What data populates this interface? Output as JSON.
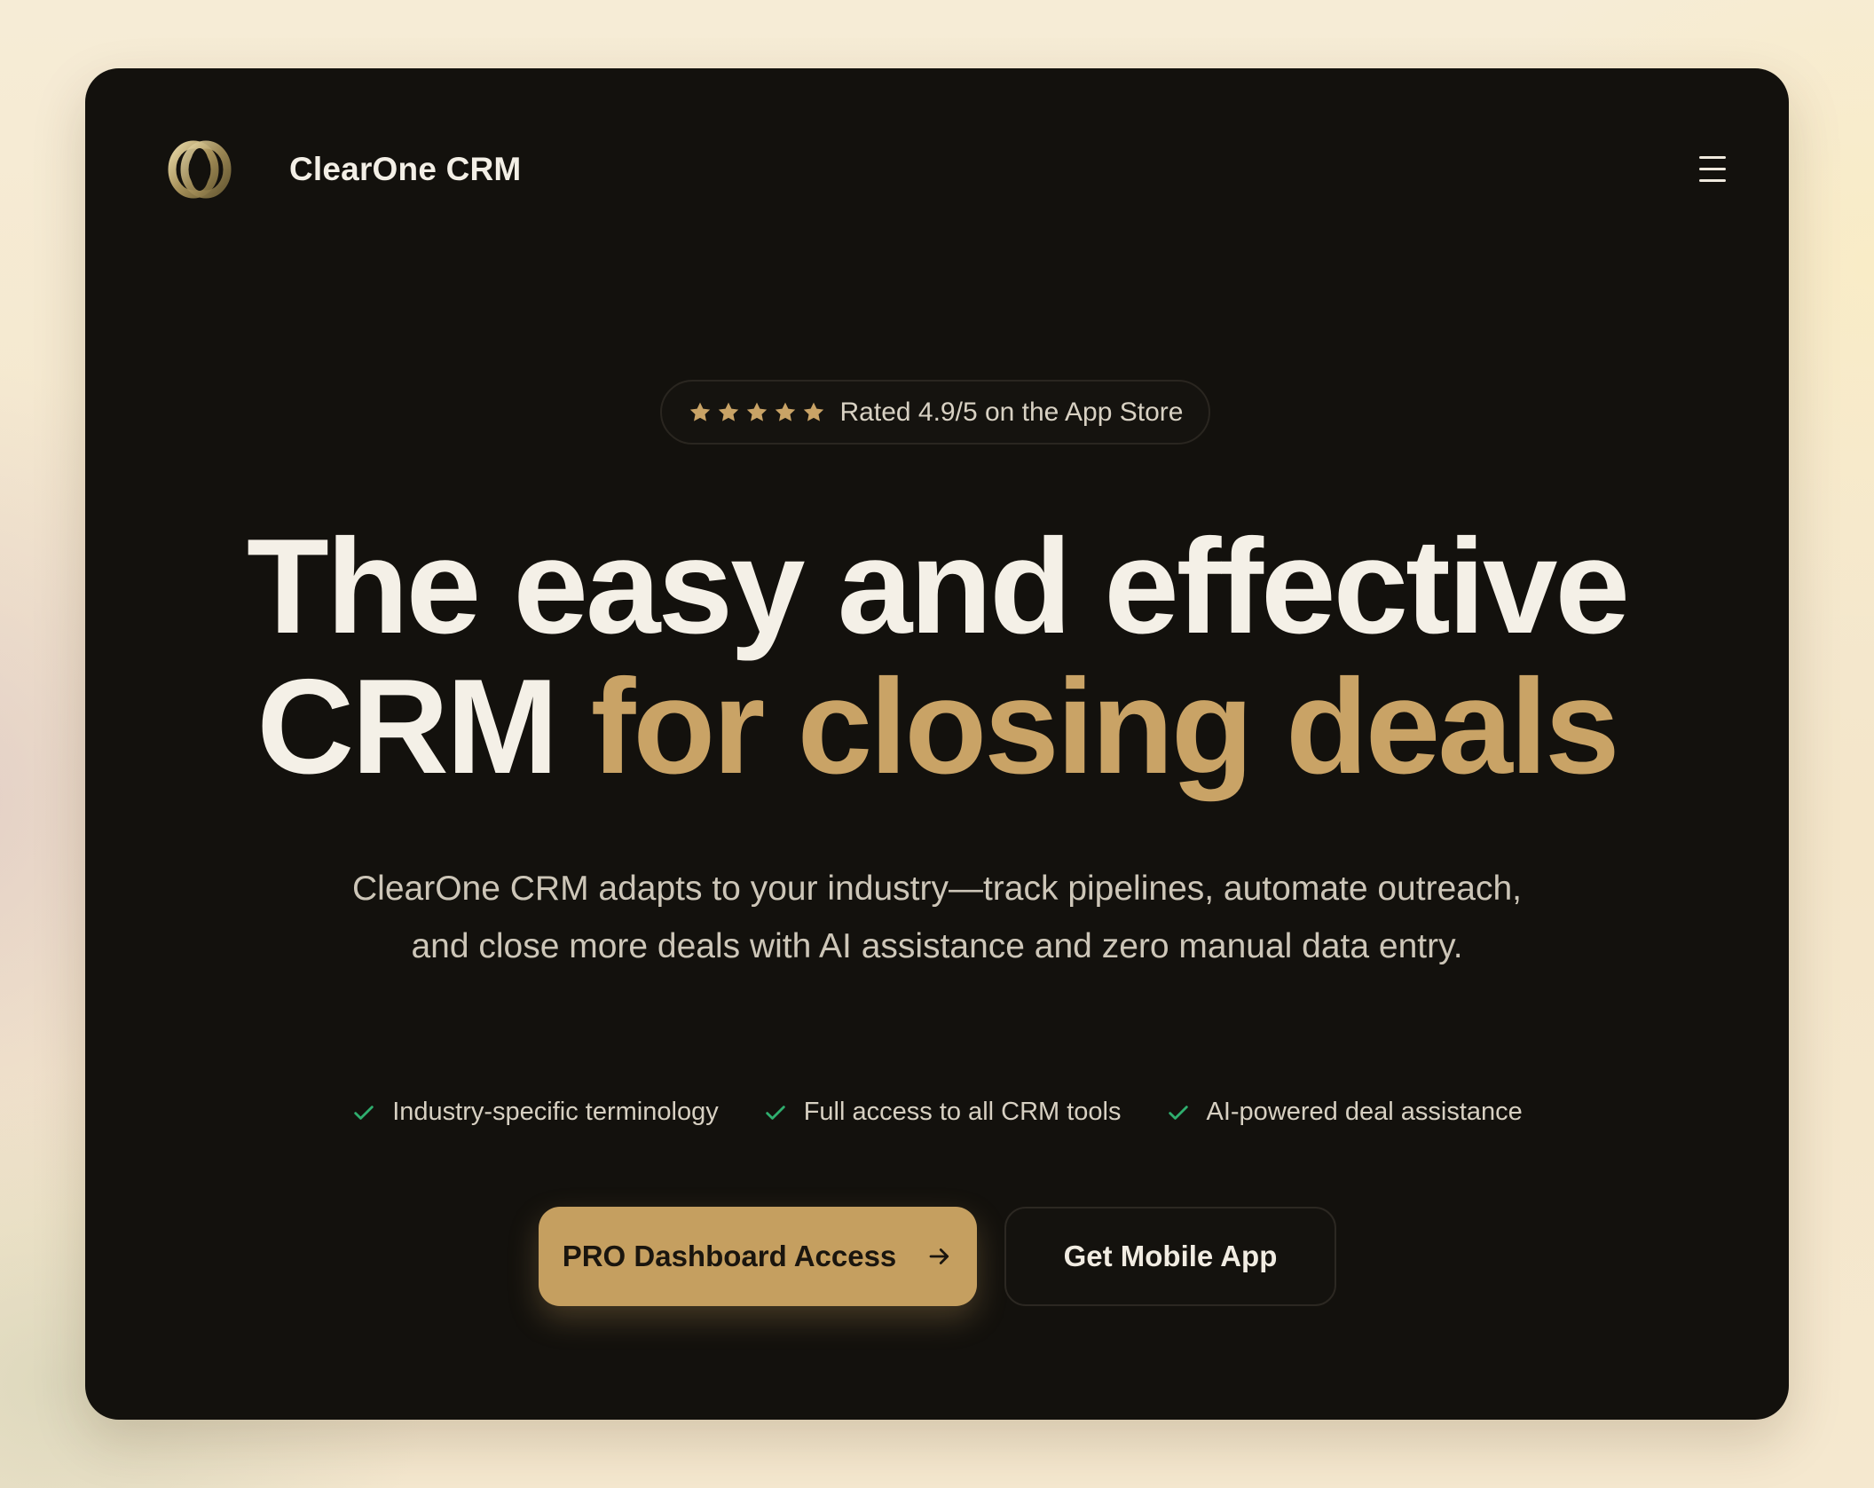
{
  "brand": {
    "name": "ClearOne CRM",
    "logo_icon": "interlocking-rings-logo"
  },
  "header": {
    "menu_icon": "hamburger-menu-icon"
  },
  "rating": {
    "stars": 5,
    "star_icon": "star-icon",
    "text": "Rated 4.9/5 on the App Store"
  },
  "hero": {
    "headline_line1": "The easy and effective",
    "headline_line2_plain": "CRM",
    "headline_line2_accent": "for closing deals",
    "subtext": "ClearOne CRM adapts to your industry—track pipelines, automate outreach, and close more deals with AI assistance and zero manual data entry."
  },
  "features": [
    {
      "label": "Industry-specific terminology",
      "icon": "check-icon"
    },
    {
      "label": "Full access to all CRM tools",
      "icon": "check-icon"
    },
    {
      "label": "AI-powered deal assistance",
      "icon": "check-icon"
    }
  ],
  "cta": {
    "primary_label": "PRO Dashboard Access",
    "primary_icon": "arrow-right-icon",
    "secondary_label": "Get Mobile App"
  },
  "colors": {
    "background": "#f5e9d0",
    "card": "#13110d",
    "accent_gold": "#c9a366",
    "check_green": "#2fae6e",
    "headline_text": "#f4f0e7"
  }
}
